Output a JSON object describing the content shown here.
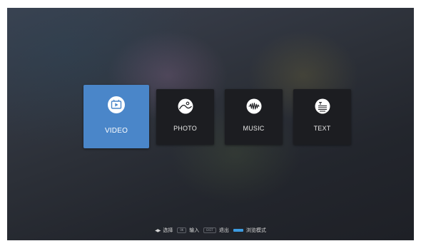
{
  "menu": {
    "items": [
      {
        "label": "VIDEO",
        "icon": "video-play-icon"
      },
      {
        "label": "PHOTO",
        "icon": "photo-landscape-icon"
      },
      {
        "label": "MUSIC",
        "icon": "music-waveform-icon"
      },
      {
        "label": "TEXT",
        "icon": "text-document-icon"
      }
    ],
    "selected": "VIDEO"
  },
  "hints": {
    "select_label": "选择",
    "ok_key": "OK",
    "enter_label": "输入",
    "exit_key": "EXIT",
    "exit_label": "退出",
    "browse_label": "浏览模式"
  },
  "colors": {
    "selected_tile": "#4a86c9",
    "tile": "#1c1d21",
    "blue_key": "#3d9be0"
  }
}
